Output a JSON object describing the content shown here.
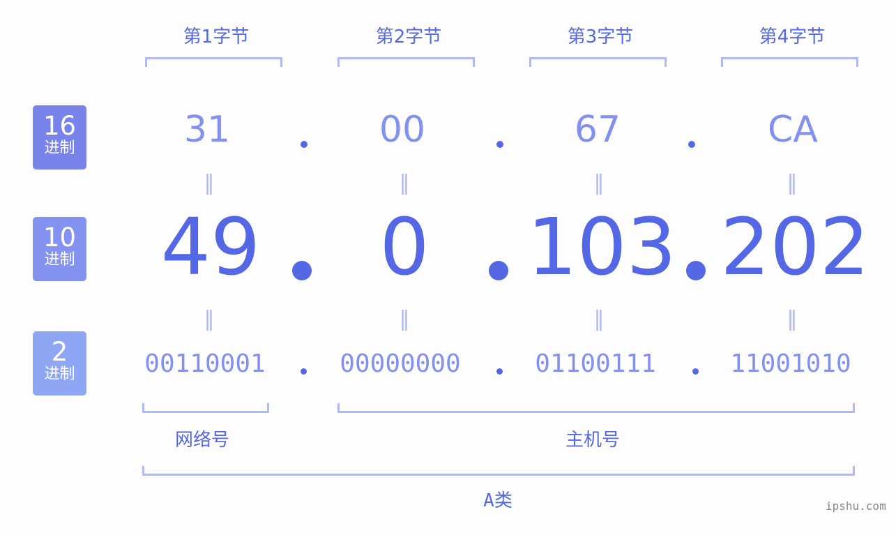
{
  "bytes": [
    {
      "title": "第1字节",
      "hex": "31",
      "dec": "49",
      "bin": "00110001"
    },
    {
      "title": "第2字节",
      "hex": "00",
      "dec": "0",
      "bin": "00000000"
    },
    {
      "title": "第3字节",
      "hex": "67",
      "dec": "103",
      "bin": "01100111"
    },
    {
      "title": "第4字节",
      "hex": "CA",
      "dec": "202",
      "bin": "11001010"
    }
  ],
  "badges": {
    "hex": {
      "num": "16",
      "unit": "进制",
      "color": "#7884ea"
    },
    "dec": {
      "num": "10",
      "unit": "进制",
      "color": "#8593f0"
    },
    "bin": {
      "num": "2",
      "unit": "进制",
      "color": "#8fa6f4"
    }
  },
  "equals_sign": "=",
  "sections": {
    "network": "网络号",
    "host": "主机号",
    "class": "A类"
  },
  "watermark": "ipshu.com",
  "colors": {
    "primary": "#5468e6",
    "secondary": "#8390ee",
    "bracket": "#b1baf6",
    "background": "#fcfdfc"
  }
}
